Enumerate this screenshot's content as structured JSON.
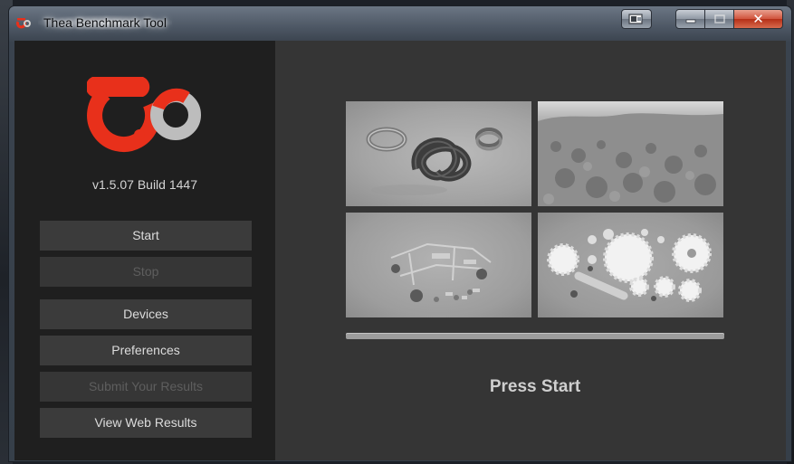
{
  "window": {
    "title": "Thea Benchmark Tool"
  },
  "sidebar": {
    "version": "v1.5.07 Build 1447",
    "buttons": [
      {
        "label": "Start",
        "enabled": true
      },
      {
        "label": "Stop",
        "enabled": false
      },
      {
        "label": "Devices",
        "enabled": true
      },
      {
        "label": "Preferences",
        "enabled": true
      },
      {
        "label": "Submit Your Results",
        "enabled": false
      },
      {
        "label": "View Web Results",
        "enabled": true
      }
    ]
  },
  "main": {
    "progress": 0,
    "status": "Press Start"
  },
  "colors": {
    "brand_red": "#e8301b",
    "brand_gray": "#bdbdbd",
    "sidebar_bg": "#1f1f1f",
    "main_bg": "#353535",
    "button_bg": "#3b3b3b"
  },
  "icons": [
    "thea-logo-icon",
    "snap-window-icon",
    "minimize-icon",
    "maximize-icon",
    "close-icon"
  ]
}
